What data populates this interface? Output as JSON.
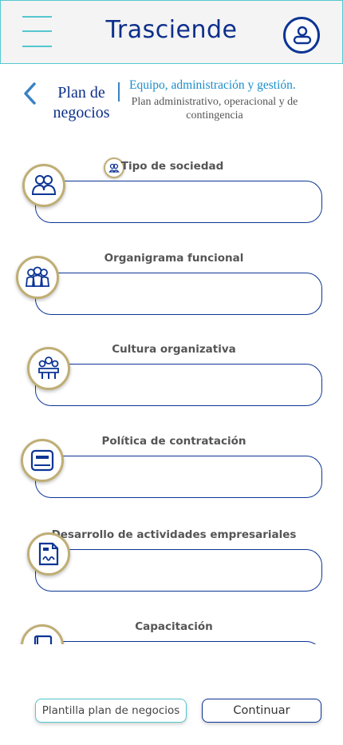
{
  "app": {
    "title": "Trasciende"
  },
  "header": {
    "menu_icon": "hamburger-icon",
    "profile_icon": "user-profile-icon"
  },
  "nav": {
    "back_icon": "chevron-left-icon"
  },
  "section": {
    "title": "Plan de negocios",
    "subtitle": "Equipo, administración y gestión.",
    "description": "Plan administrativo, operacional y de contingencia"
  },
  "fields": [
    {
      "label": "Tipo de sociedad",
      "icon": "partners-icon"
    },
    {
      "label": "Organigrama funcional",
      "icon": "team-icon"
    },
    {
      "label": "Cultura organizativa",
      "icon": "group-culture-icon"
    },
    {
      "label": "Política de contratación",
      "icon": "document-icon"
    },
    {
      "label": "Desarrollo de actividades empresariales",
      "icon": "signed-document-icon"
    },
    {
      "label": "Capacitación",
      "icon": "book-icon"
    }
  ],
  "actions": {
    "template_label": "Plantilla plan de negocios",
    "continue_label": "Continuar"
  },
  "colors": {
    "primary": "#0d2f8c",
    "accent": "#55c7cf",
    "icon_ring": "#bfae74",
    "subtitle": "#1a8ecb"
  }
}
